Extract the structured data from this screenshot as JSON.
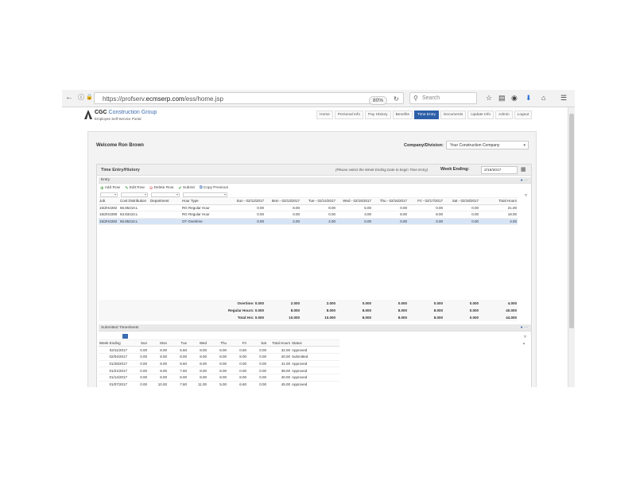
{
  "browser": {
    "url_prefix": "https://profserv.",
    "url_domain": "ecmserp.com",
    "url_path": "/ess/home.jsp",
    "zoom": "80%",
    "search_placeholder": "Search",
    "icons": [
      "back-icon",
      "info-icon",
      "lock-icon",
      "reload-icon",
      "star-icon",
      "clipboard-icon",
      "pocket-icon",
      "download-icon",
      "home-icon",
      "menu-icon"
    ]
  },
  "app": {
    "logo_ccc": "CGC",
    "logo_group": "Construction Group",
    "logo_subtitle": "Employee Self-Service Portal",
    "nav": [
      "Home",
      "Personal Info",
      "Pay History",
      "Benefits",
      "Time Entry",
      "Documents",
      "Update Info",
      "Admin",
      "Logout"
    ],
    "active_nav": "Time Entry"
  },
  "welcome": "Welcome Ron Brown",
  "company": {
    "label": "Company/Division:",
    "value": "Your Construction Company"
  },
  "time_entry": {
    "title": "Time Entry/History",
    "hint": "(Please select the Week Ending Date to begin Time Entry)",
    "week_ending_label": "Week Ending:",
    "week_ending_value": "2/18/2017",
    "entry_title": "Entry",
    "toolbar": {
      "add_row": "Add Row",
      "edit_row": "Edit Row",
      "delete_row": "Delete Row",
      "submit": "Submit",
      "copy_previous": "Copy Previous"
    },
    "columns": [
      "Job",
      "Cost Distribution",
      "Department",
      "Hour Type",
      "Sun - 02/12/2017",
      "Mon - 02/13/2017",
      "Tue - 02/14/2017",
      "Wed - 02/15/2017",
      "Thu - 02/16/2017",
      "Fri - 02/17/2017",
      "Sat - 02/18/2017",
      "Total Hours"
    ],
    "rows": [
      {
        "job": "15/ZH2282",
        "cost": "65.85210.L",
        "dept": "",
        "type": "RG Regular Hour",
        "days": [
          "0.00",
          "8.00",
          "8.00",
          "5.00",
          "0.00",
          "0.00",
          "0.00"
        ],
        "total": "21.00",
        "selected": false
      },
      {
        "job": "15/ZH2280",
        "cost": "63.83410.L",
        "dept": "",
        "type": "RG Regular Hour",
        "days": [
          "0.00",
          "0.00",
          "0.00",
          "3.00",
          "8.00",
          "8.00",
          "0.00"
        ],
        "total": "19.00",
        "selected": false
      },
      {
        "job": "15/ZH2282",
        "cost": "65.85210.L",
        "dept": "",
        "type": "OT Overtime",
        "days": [
          "0.00",
          "2.00",
          "2.00",
          "0.00",
          "0.00",
          "0.00",
          "0.00"
        ],
        "total": "4.00",
        "selected": true
      }
    ],
    "totals": [
      {
        "label": "Overtime: 0.000",
        "days": [
          "2.000",
          "2.000",
          "0.000",
          "0.000",
          "0.000",
          "0.000"
        ],
        "total": "4.000"
      },
      {
        "label": "Regular Hours: 0.000",
        "days": [
          "8.000",
          "8.000",
          "8.000",
          "8.000",
          "8.000",
          "0.000"
        ],
        "total": "40.000"
      },
      {
        "label": "Total Hrs: 0.000",
        "days": [
          "10.000",
          "10.000",
          "8.000",
          "8.000",
          "8.000",
          "0.000"
        ],
        "total": "44.000"
      }
    ]
  },
  "submitted": {
    "title": "Submitted Timesheets",
    "columns": [
      "Week Ending",
      "Sun",
      "Mon",
      "Tue",
      "Wed",
      "Thu",
      "Fri",
      "Sat",
      "Total Hours",
      "Status"
    ],
    "rows": [
      {
        "we": "02/11/2017",
        "d": [
          "0.00",
          "8.00",
          "5.60",
          "8.00",
          "8.00",
          "0.60",
          "0.00"
        ],
        "total": "32.00",
        "status": "Approved"
      },
      {
        "we": "02/04/2017",
        "d": [
          "0.00",
          "8.00",
          "8.00",
          "8.00",
          "8.00",
          "8.00",
          "0.00"
        ],
        "total": "40.00",
        "status": "Submitted"
      },
      {
        "we": "01/28/2017",
        "d": [
          "0.00",
          "8.00",
          "8.60",
          "8.00",
          "8.00",
          "0.00",
          "0.00"
        ],
        "total": "41.00",
        "status": "Approved"
      },
      {
        "we": "01/21/2017",
        "d": [
          "0.00",
          "8.00",
          "7.60",
          "8.00",
          "8.00",
          "0.00",
          "0.00"
        ],
        "total": "38.00",
        "status": "Approved"
      },
      {
        "we": "01/14/2017",
        "d": [
          "0.00",
          "8.00",
          "8.00",
          "8.00",
          "8.00",
          "8.00",
          "0.00"
        ],
        "total": "40.00",
        "status": "Approved"
      },
      {
        "we": "01/07/2017",
        "d": [
          "0.00",
          "10.00",
          "7.60",
          "11.00",
          "5.00",
          "6.60",
          "0.00"
        ],
        "total": "45.00",
        "status": "Approved"
      }
    ]
  }
}
